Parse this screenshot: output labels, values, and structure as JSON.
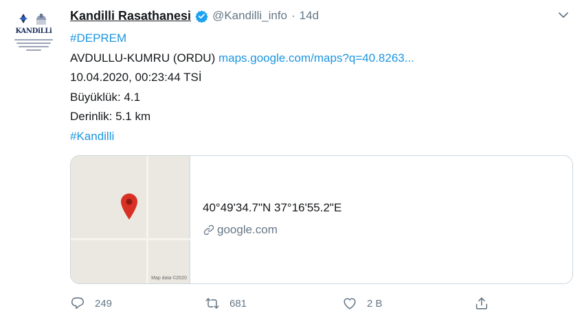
{
  "tweet": {
    "author": {
      "name": "Kandilli Rasathanesi",
      "handle": "@Kandilli_info",
      "verified": true,
      "avatar_label": "KANDiLLi"
    },
    "separator": "·",
    "time": "14d",
    "lines": [
      {
        "segments": [
          {
            "text": "#DEPREM",
            "kind": "hashtag"
          }
        ]
      },
      {
        "segments": [
          {
            "text": "AVDULLU-KUMRU (ORDU) ",
            "kind": "text"
          },
          {
            "text": "maps.google.com/maps?q=40.8263...",
            "kind": "link"
          }
        ]
      },
      {
        "segments": [
          {
            "text": "10.04.2020, 00:23:44 TSİ",
            "kind": "text"
          }
        ]
      },
      {
        "segments": [
          {
            "text": "Büyüklük: 4.1",
            "kind": "text"
          }
        ]
      },
      {
        "segments": [
          {
            "text": "Derinlik: 5.1 km",
            "kind": "text"
          }
        ]
      },
      {
        "segments": [
          {
            "text": "#Kandilli",
            "kind": "hashtag"
          }
        ]
      }
    ],
    "card": {
      "title": "40°49'34.7\"N 37°16'55.2\"E",
      "domain": "google.com",
      "map_credit": "Map data ©2020"
    },
    "actions": {
      "reply_count": "249",
      "retweet_count": "681",
      "like_count": "2 B"
    },
    "icons": {
      "verified": "verified-badge-icon",
      "caret": "chevron-down-icon",
      "pin": "map-pin-icon",
      "link": "link-icon",
      "reply": "reply-icon",
      "retweet": "retweet-icon",
      "like": "heart-icon",
      "share": "share-icon"
    },
    "colors": {
      "link": "#1b95e0",
      "verified": "#1da1f2",
      "muted": "#657786",
      "pin": "#d93025"
    }
  }
}
